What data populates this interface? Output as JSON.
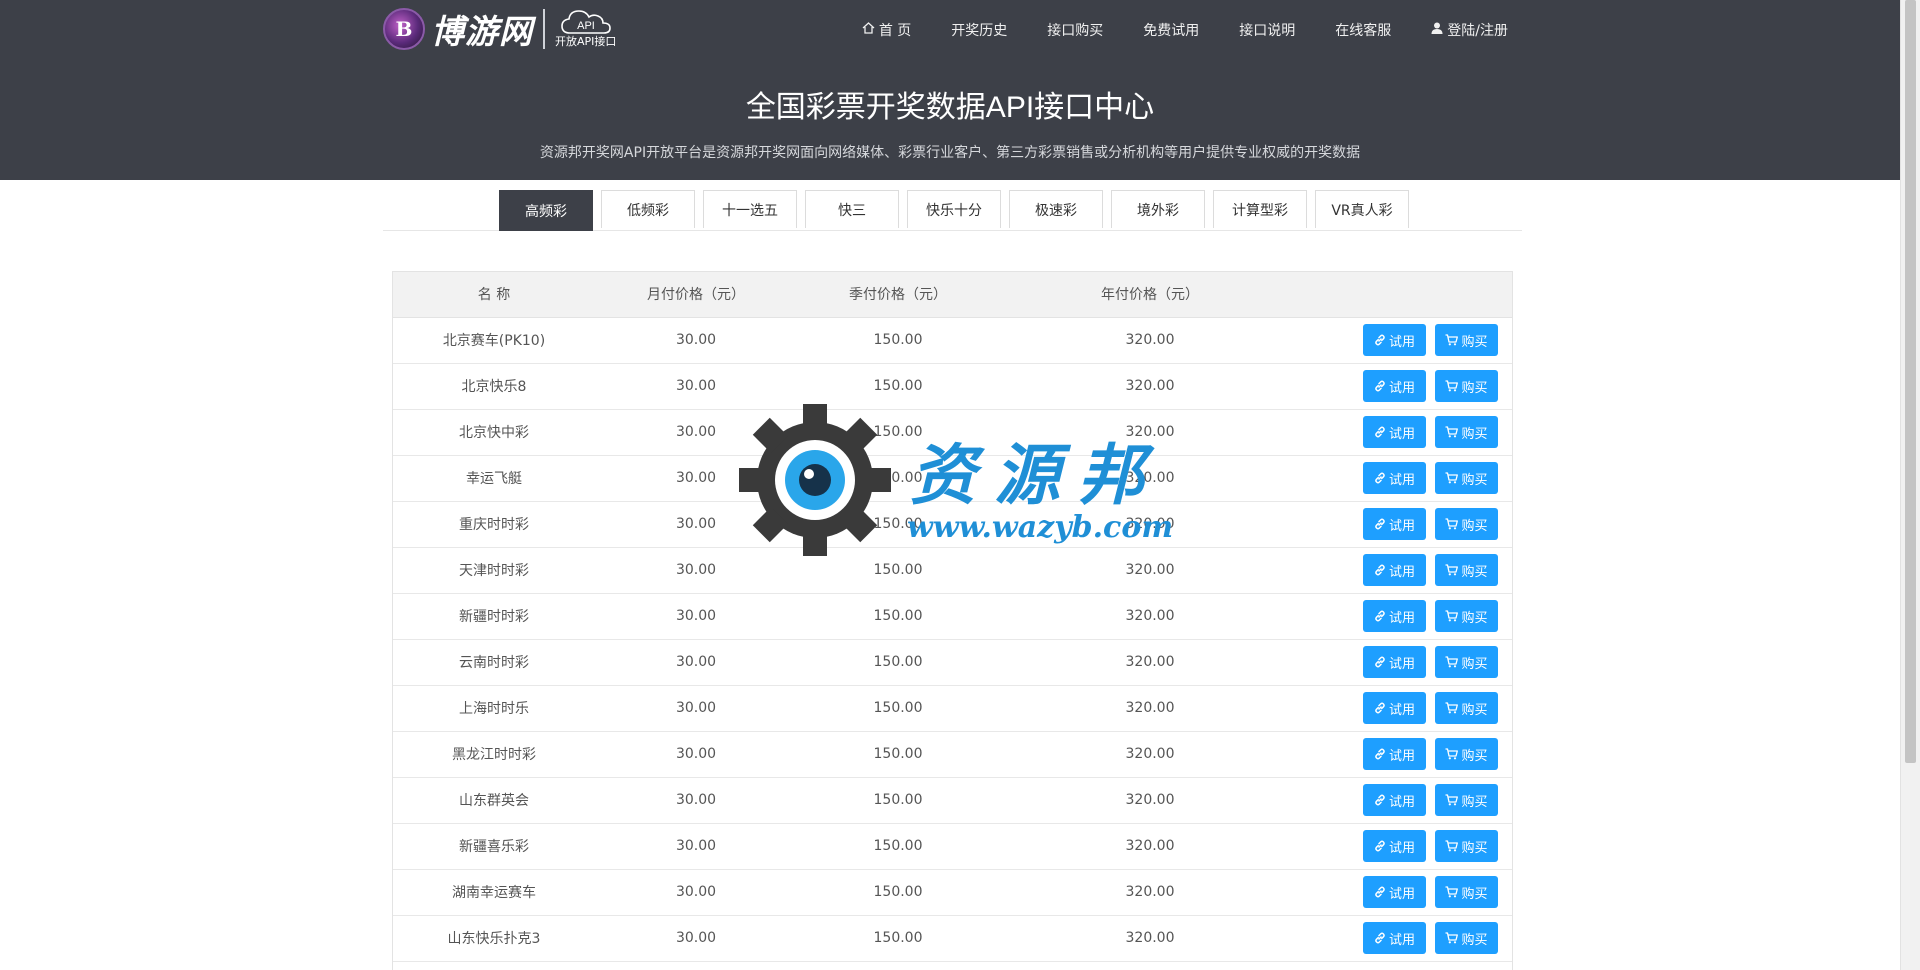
{
  "header": {
    "logo_name": "博游网",
    "logo_badge": "B",
    "logo_api": "API",
    "logo_api_sub": "开放API接口",
    "nav": [
      {
        "label": "首 页",
        "icon": "home-icon"
      },
      {
        "label": "开奖历史"
      },
      {
        "label": "接口购买"
      },
      {
        "label": "免费试用"
      },
      {
        "label": "接口说明"
      },
      {
        "label": "在线客服"
      },
      {
        "label": "登陆/注册",
        "icon": "user-icon"
      }
    ],
    "title": "全国彩票开奖数据API接口中心",
    "subtitle": "资源邦开奖网API开放平台是资源邦开奖网面向网络媒体、彩票行业客户、第三方彩票销售或分析机构等用户提供专业权威的开奖数据"
  },
  "tabs": [
    {
      "label": "高频彩",
      "active": true
    },
    {
      "label": "低频彩"
    },
    {
      "label": "十一选五"
    },
    {
      "label": "快三"
    },
    {
      "label": "快乐十分"
    },
    {
      "label": "极速彩"
    },
    {
      "label": "境外彩"
    },
    {
      "label": "计算型彩"
    },
    {
      "label": "VR真人彩"
    }
  ],
  "table": {
    "headers": [
      "名 称",
      "月付价格（元）",
      "季付价格（元）",
      "年付价格（元）",
      ""
    ],
    "trial_label": "试用",
    "buy_label": "购买",
    "rows": [
      {
        "name": "北京赛车(PK10)",
        "month": "30.00",
        "quarter": "150.00",
        "year": "320.00"
      },
      {
        "name": "北京快乐8",
        "month": "30.00",
        "quarter": "150.00",
        "year": "320.00"
      },
      {
        "name": "北京快中彩",
        "month": "30.00",
        "quarter": "150.00",
        "year": "320.00"
      },
      {
        "name": "幸运飞艇",
        "month": "30.00",
        "quarter": "150.00",
        "year": "320.00"
      },
      {
        "name": "重庆时时彩",
        "month": "30.00",
        "quarter": "150.00",
        "year": "320.00"
      },
      {
        "name": "天津时时彩",
        "month": "30.00",
        "quarter": "150.00",
        "year": "320.00"
      },
      {
        "name": "新疆时时彩",
        "month": "30.00",
        "quarter": "150.00",
        "year": "320.00"
      },
      {
        "name": "云南时时彩",
        "month": "30.00",
        "quarter": "150.00",
        "year": "320.00"
      },
      {
        "name": "上海时时乐",
        "month": "30.00",
        "quarter": "150.00",
        "year": "320.00"
      },
      {
        "name": "黑龙江时时彩",
        "month": "30.00",
        "quarter": "150.00",
        "year": "320.00"
      },
      {
        "name": "山东群英会",
        "month": "30.00",
        "quarter": "150.00",
        "year": "320.00"
      },
      {
        "name": "新疆喜乐彩",
        "month": "30.00",
        "quarter": "150.00",
        "year": "320.00"
      },
      {
        "name": "湖南幸运赛车",
        "month": "30.00",
        "quarter": "150.00",
        "year": "320.00"
      },
      {
        "name": "山东快乐扑克3",
        "month": "30.00",
        "quarter": "150.00",
        "year": "320.00"
      }
    ]
  },
  "watermark": {
    "text": "资源邦",
    "url": "www.wazyb.com"
  },
  "colors": {
    "header_bg": "#3d4048",
    "accent": "#1e9fff",
    "watermark": "#1f8fd6"
  }
}
